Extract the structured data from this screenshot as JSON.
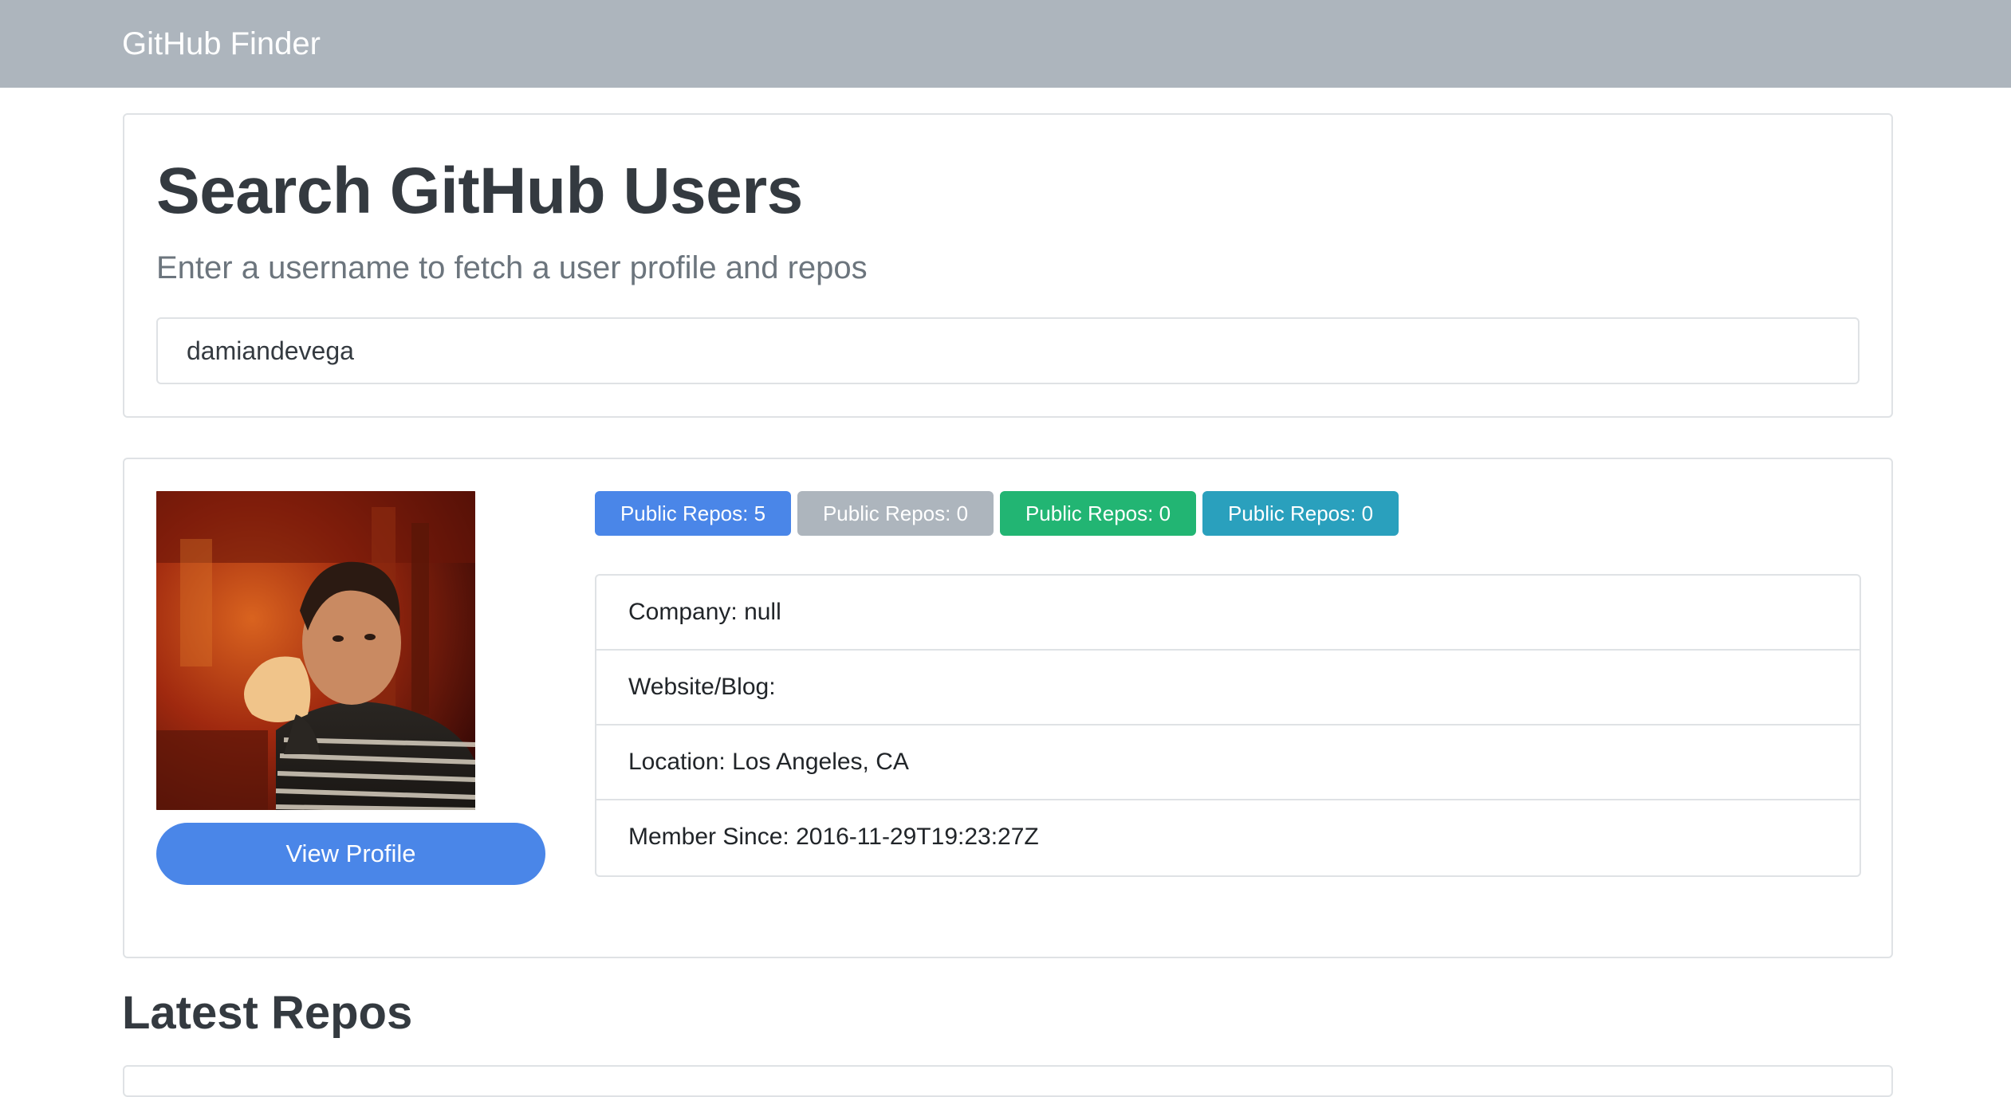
{
  "navbar": {
    "brand": "GitHub Finder"
  },
  "search": {
    "title": "Search GitHub Users",
    "lead": "Enter a username to fetch a user profile and repos",
    "input_value": "damiandevega"
  },
  "profile": {
    "view_profile_label": "View Profile",
    "badges": [
      {
        "label": "Public Repos: 5",
        "color": "#4a86e8"
      },
      {
        "label": "Public Repos: 0",
        "color": "#adb5bd"
      },
      {
        "label": "Public Repos: 0",
        "color": "#22b573"
      },
      {
        "label": "Public Repos: 0",
        "color": "#2aa0bd"
      }
    ],
    "details": [
      "Company: null",
      "Website/Blog:",
      "Location: Los Angeles, CA",
      "Member Since: 2016-11-29T19:23:27Z"
    ]
  },
  "repos": {
    "heading": "Latest Repos"
  },
  "colors": {
    "navbar_bg": "#adb5bd",
    "primary": "#4a86e8",
    "border": "#dfe2e5",
    "heading": "#343a40",
    "muted": "#6c757d"
  }
}
